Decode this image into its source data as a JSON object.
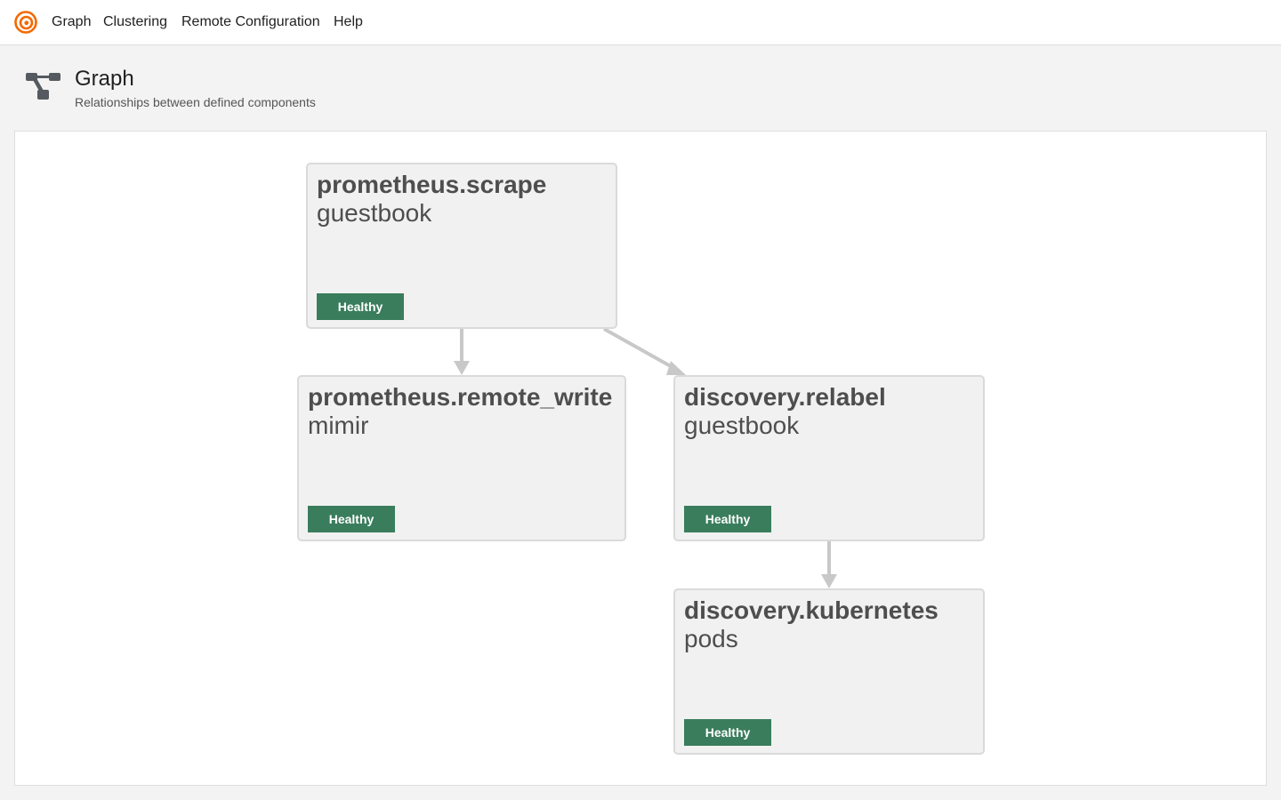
{
  "nav": {
    "logo_icon": "grafana-alloy-logo-icon",
    "items": [
      {
        "label": "Graph"
      },
      {
        "label": "Clustering"
      },
      {
        "label": "Remote Configuration"
      },
      {
        "label": "Help"
      }
    ]
  },
  "header": {
    "icon": "graph-icon",
    "title": "Graph",
    "subtitle": "Relationships between defined components"
  },
  "colors": {
    "accent": "#f46800",
    "healthy": "#3a7d5c",
    "edge": "#c8c8c8"
  },
  "graph": {
    "nodes": [
      {
        "type": "prometheus.scrape",
        "label": "guestbook",
        "health": "Healthy"
      },
      {
        "type": "prometheus.remote_write",
        "label": "mimir",
        "health": "Healthy"
      },
      {
        "type": "discovery.relabel",
        "label": "guestbook",
        "health": "Healthy"
      },
      {
        "type": "discovery.kubernetes",
        "label": "pods",
        "health": "Healthy"
      }
    ],
    "edges": [
      {
        "from": "prometheus.scrape guestbook",
        "to": "prometheus.remote_write mimir"
      },
      {
        "from": "prometheus.scrape guestbook",
        "to": "discovery.relabel guestbook"
      },
      {
        "from": "discovery.relabel guestbook",
        "to": "discovery.kubernetes pods"
      }
    ]
  }
}
